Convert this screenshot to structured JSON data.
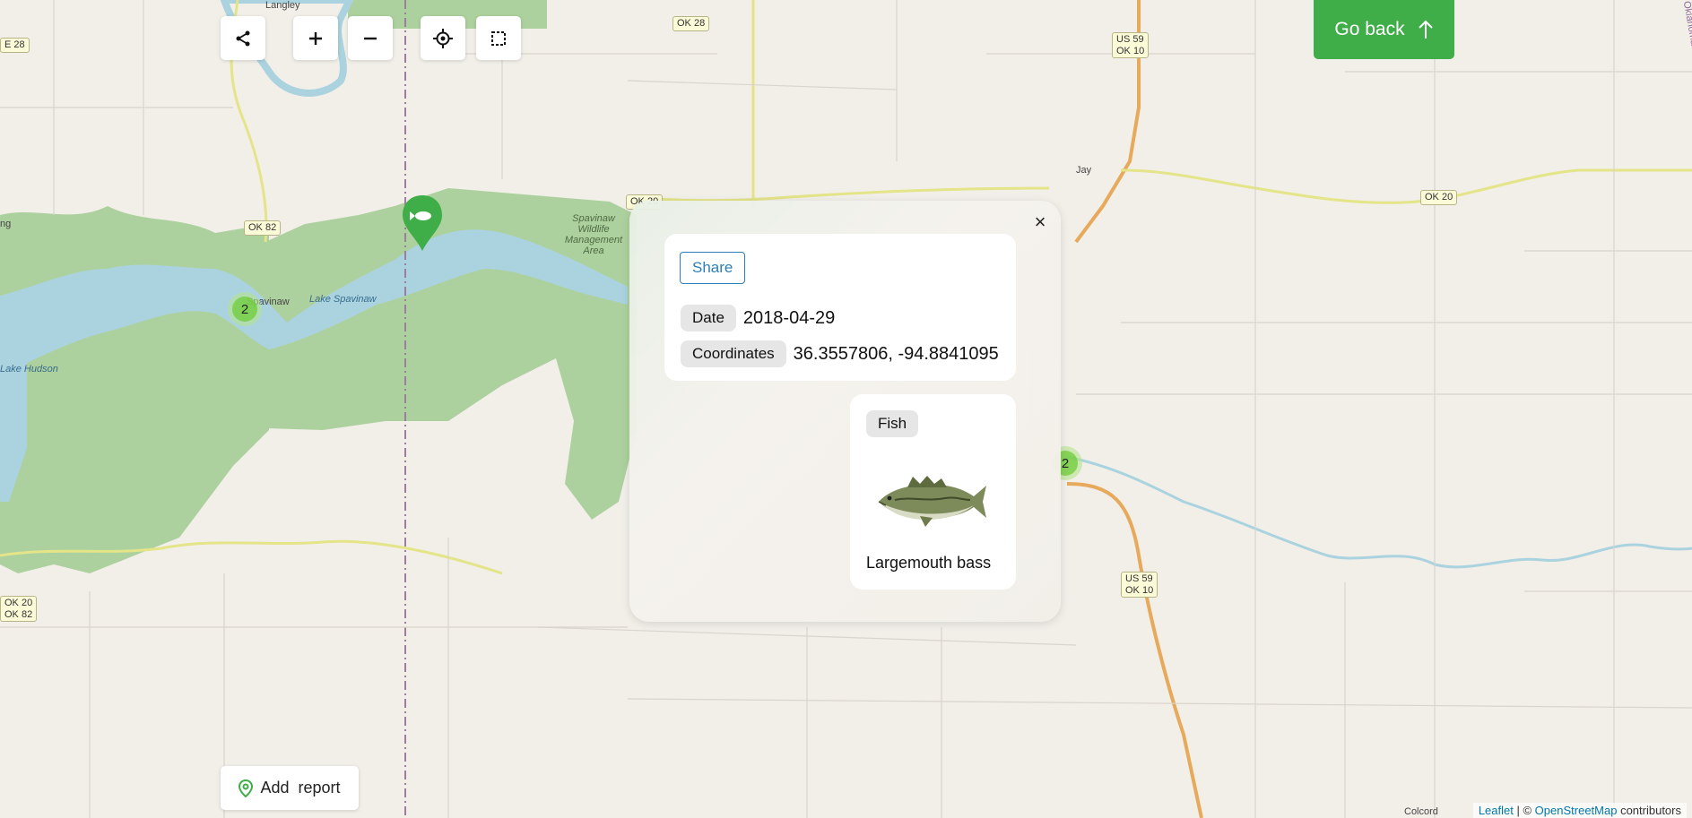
{
  "map": {
    "places": [
      {
        "label": "Langley"
      },
      {
        "label": "Jay"
      },
      {
        "label": "Spavinaw"
      },
      {
        "label": "Lake Spavinaw"
      },
      {
        "label": "Spavinaw Wildlife Management Area"
      },
      {
        "label": "Lake Hudson"
      },
      {
        "label": "Colcord"
      },
      {
        "label": "Oklahoma"
      },
      {
        "label": "ng"
      }
    ],
    "shields": [
      {
        "label": "OK 28"
      },
      {
        "label": "US 59\nOK 10"
      },
      {
        "label": "OK 82"
      },
      {
        "label": "OK 20"
      },
      {
        "label": "US 59\nOK 10"
      },
      {
        "label": "OK 20\nOK 82"
      },
      {
        "label": "OK 20"
      },
      {
        "label": "E 28"
      }
    ],
    "clusters": [
      {
        "count": "2"
      },
      {
        "count": "2"
      }
    ],
    "marker_icon": "fish-marker-icon"
  },
  "controls": {
    "share_icon": "share-icon",
    "zoom_in_icon": "plus-icon",
    "zoom_out_icon": "minus-icon",
    "locate_icon": "locate-icon",
    "select_icon": "select-area-icon"
  },
  "go_back": {
    "label": "Go back",
    "icon": "arrow-up-icon"
  },
  "add_report": {
    "label": "Add  report",
    "icon": "map-pin-icon"
  },
  "attribution": {
    "leaflet": "Leaflet",
    "sep": " | © ",
    "osm": "OpenStreetMap",
    "suffix": " contributors"
  },
  "popup": {
    "close": "×",
    "share_label": "Share",
    "date_label": "Date",
    "date_value": "2018-04-29",
    "coords_label": "Coordinates",
    "coords_value": "36.3557806, -94.8841095",
    "species_category": "Fish",
    "species_name": "Largemouth bass"
  },
  "colors": {
    "accent_green": "#3fae49",
    "link_blue": "#2f7fb5",
    "forest": "#add19e",
    "water": "#aad3df",
    "road_yellow": "#f7fabf"
  }
}
